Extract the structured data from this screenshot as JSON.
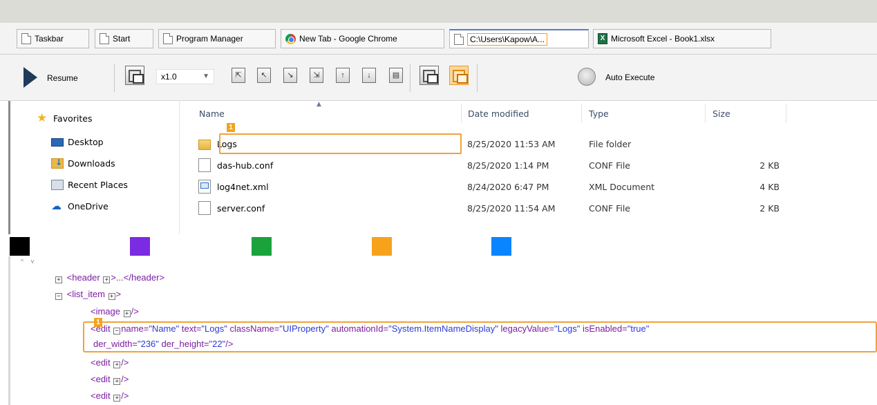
{
  "tabs": [
    {
      "label": "Taskbar",
      "icon": "document-icon"
    },
    {
      "label": "Start",
      "icon": "document-icon"
    },
    {
      "label": "Program Manager",
      "icon": "document-icon"
    },
    {
      "label": "New Tab - Google Chrome",
      "icon": "chrome-icon"
    },
    {
      "label": "C:\\Users\\Kapow\\A...",
      "icon": "document-icon",
      "active": true
    },
    {
      "label": "Microsoft Excel - Book1.xlsx",
      "icon": "excel-icon"
    }
  ],
  "toolbar": {
    "resume_label": "Resume",
    "zoom_value": "x1.0",
    "auto_execute_label": "Auto Execute",
    "highlight_color": "#f0a23a"
  },
  "explorer": {
    "nav": [
      {
        "label": "Favorites",
        "icon": "star-icon"
      },
      {
        "label": "Desktop",
        "icon": "desktop-icon"
      },
      {
        "label": "Downloads",
        "icon": "downloads-icon"
      },
      {
        "label": "Recent Places",
        "icon": "recent-places-icon"
      },
      {
        "label": "OneDrive",
        "icon": "onedrive-icon"
      }
    ],
    "columns": {
      "name": "Name",
      "date": "Date modified",
      "type": "Type",
      "size": "Size"
    },
    "files": [
      {
        "name": "Logs",
        "date": "8/25/2020 11:53 AM",
        "type": "File folder",
        "size": "",
        "icon": "folder-icon"
      },
      {
        "name": "das-hub.conf",
        "date": "8/25/2020 1:14 PM",
        "type": "CONF File",
        "size": "2 KB",
        "icon": "file-icon"
      },
      {
        "name": "log4net.xml",
        "date": "8/24/2020 6:47 PM",
        "type": "XML Document",
        "size": "4 KB",
        "icon": "xml-file-icon"
      },
      {
        "name": "server.conf",
        "date": "8/25/2020 11:54 AM",
        "type": "CONF File",
        "size": "2 KB",
        "icon": "file-icon"
      }
    ],
    "badge": "1"
  },
  "swatches": [
    "#000000",
    "#7b2be2",
    "#1aa33b",
    "#f7a21b",
    "#0a84ff"
  ],
  "xml": {
    "header": {
      "open": "<header",
      "mid": ">...</header>"
    },
    "list_item": "<list_item",
    "image": {
      "tag": "<image",
      "close": "/>"
    },
    "edit_line1": {
      "tag": "<edit",
      "attrs": [
        {
          "name": "name=",
          "value": "\"Name\""
        },
        {
          "name": "text=",
          "value": "\"Logs\""
        },
        {
          "name": "className=",
          "value": "\"UIProperty\""
        },
        {
          "name": "automationId=",
          "value": "\"System.ItemNameDisplay\""
        },
        {
          "name": "legacyValue=",
          "value": "\"Logs\""
        },
        {
          "name": "isEnabled=",
          "value": "\"true\""
        }
      ]
    },
    "edit_line2": {
      "attrs": [
        {
          "name": "der_width=",
          "value": "\"236\""
        },
        {
          "name": "der_height=",
          "value": "\"22\""
        }
      ],
      "close": "/>"
    },
    "edit_rows": [
      "<edit",
      "<edit",
      "<edit"
    ],
    "close": "/>",
    "gt": ">",
    "badge": "1"
  }
}
